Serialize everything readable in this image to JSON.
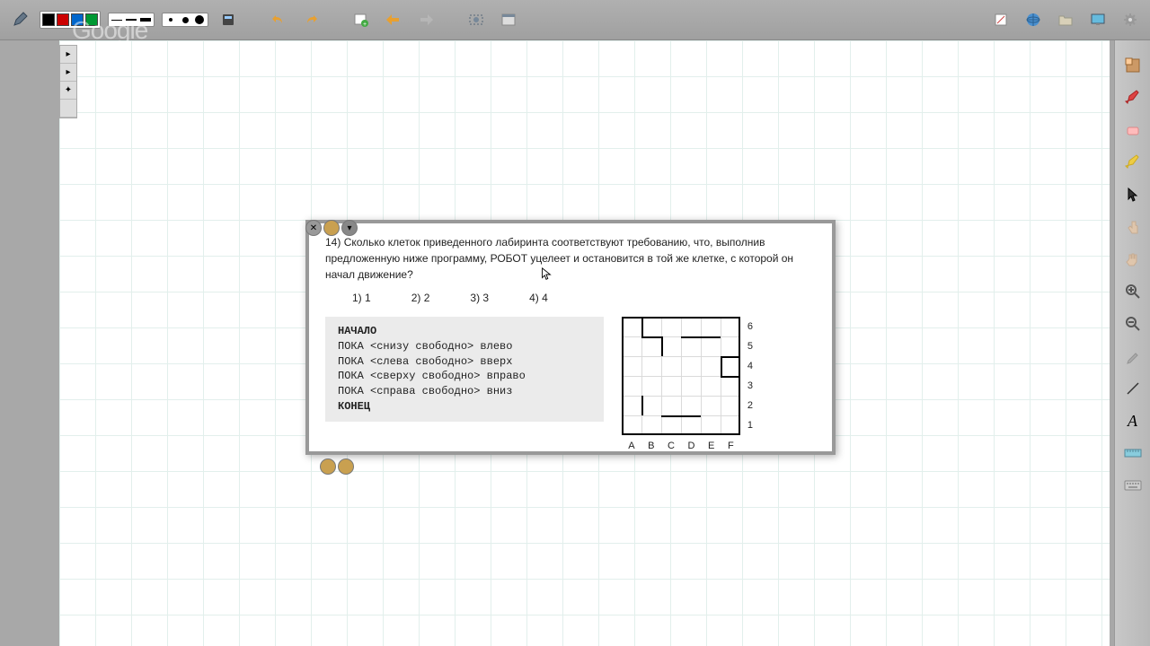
{
  "watermark": "Google",
  "toolbar": {
    "colors": [
      "#000000",
      "#cc0000",
      "#0066cc",
      "#009933"
    ],
    "icons": [
      "pen",
      "colors",
      "line-thin",
      "line-med",
      "line-thick",
      "dot-small",
      "dot-med",
      "dot-large",
      "calc",
      "undo",
      "redo",
      "page",
      "folder-left",
      "folder-right",
      "hand",
      "window",
      "note",
      "globe",
      "folder",
      "monitor",
      "gear"
    ]
  },
  "rightbar": {
    "tools": [
      "select",
      "pen-red",
      "eraser",
      "pen-yellow",
      "pointer",
      "finger",
      "hand",
      "zoom-in",
      "zoom-out",
      "eyedrop",
      "line",
      "text",
      "ruler",
      "keyboard"
    ]
  },
  "question": {
    "number": "14)",
    "text": "Сколько клеток приведенного лабиринта соответствуют требованию, что, выполнив предложенную ниже программу, РОБОТ уцелеет и остановится в той же клетке, с которой он начал движение?",
    "options": [
      {
        "n": "1)",
        "v": "1"
      },
      {
        "n": "2)",
        "v": "2"
      },
      {
        "n": "3)",
        "v": "3"
      },
      {
        "n": "4)",
        "v": "4"
      }
    ],
    "code": [
      "НАЧАЛО",
      "ПОКА <снизу свободно> влево",
      "ПОКА <слева свободно> вверх",
      "ПОКА <сверху свободно> вправо",
      "ПОКА <справа свободно> вниз",
      "КОНЕЦ"
    ],
    "maze": {
      "rows": [
        "6",
        "5",
        "4",
        "3",
        "2",
        "1"
      ],
      "cols": [
        "A",
        "B",
        "C",
        "D",
        "E",
        "F"
      ]
    }
  }
}
